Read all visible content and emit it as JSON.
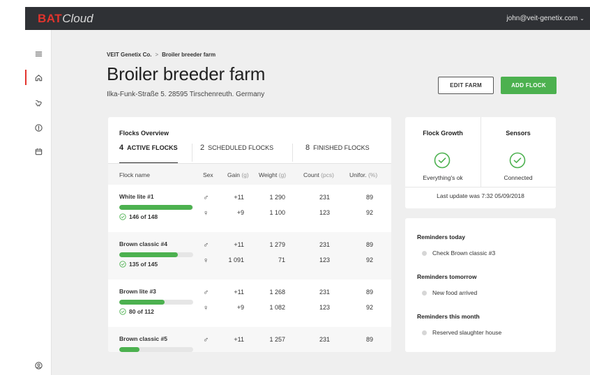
{
  "app": {
    "brand_bold": "BAT",
    "brand_light": "Cloud",
    "user_email": "john@veit-genetix.com"
  },
  "sidebar": {
    "icons": [
      "menu-icon",
      "home-icon",
      "chicken-icon",
      "alert-icon",
      "calendar-icon",
      "account-icon"
    ],
    "active": "home-icon"
  },
  "breadcrumb": {
    "company": "VEIT Genetix Co.",
    "separator": ">",
    "current": "Broiler breeder farm"
  },
  "page": {
    "title": "Broiler breeder farm",
    "address": "Ilka-Funk-Straße 5. 28595 Tirschenreuth. Germany"
  },
  "actions": {
    "edit_label": "EDIT FARM",
    "add_label": "ADD FLOCK"
  },
  "flocks": {
    "title": "Flocks Overview",
    "tabs": [
      {
        "count": "4",
        "label": "ACTIVE FLOCKS",
        "active": true
      },
      {
        "count": "2",
        "label": "SCHEDULED FLOCKS",
        "active": false
      },
      {
        "count": "8",
        "label": "FINISHED FLOCKS",
        "active": false
      }
    ],
    "columns": {
      "name": "Flock name",
      "sex": "Sex",
      "gain": "Gain",
      "gain_unit": "(g)",
      "weight": "Weight",
      "weight_unit": "(g)",
      "count": "Count",
      "count_unit": "(pcs)",
      "uniformity": "Unifor.",
      "uniformity_unit": "(%)"
    },
    "rows": [
      {
        "name": "White lite #1",
        "progress": 0.99,
        "progress_label": "146 of 148",
        "male": {
          "sex": "♂",
          "gain": "+11",
          "weight": "1 290",
          "count": "231",
          "uniformity": "89"
        },
        "female": {
          "sex": "♀",
          "gain": "+9",
          "weight": "1 100",
          "count": "123",
          "uniformity": "92"
        }
      },
      {
        "name": "Brown classic #4",
        "progress": 0.79,
        "progress_label": "135 of 145",
        "male": {
          "sex": "♂",
          "gain": "+11",
          "weight": "1 279",
          "count": "231",
          "uniformity": "89"
        },
        "female": {
          "sex": "♀",
          "gain": "1 091",
          "weight": "71",
          "count": "123",
          "uniformity": "92"
        }
      },
      {
        "name": "Brown lite #3",
        "progress": 0.61,
        "progress_label": "80 of 112",
        "male": {
          "sex": "♂",
          "gain": "+11",
          "weight": "1 268",
          "count": "231",
          "uniformity": "89"
        },
        "female": {
          "sex": "♀",
          "gain": "+9",
          "weight": "1 082",
          "count": "123",
          "uniformity": "92"
        }
      },
      {
        "name": "Brown classic #5",
        "progress": 0.27,
        "progress_label": "",
        "male": {
          "sex": "♂",
          "gain": "+11",
          "weight": "1 257",
          "count": "231",
          "uniformity": "89"
        }
      }
    ]
  },
  "status": {
    "growth_title": "Flock Growth",
    "growth_status": "Everything's ok",
    "sensors_title": "Sensors",
    "sensors_status": "Connected",
    "last_update": "Last update was 7:32 05/09/2018"
  },
  "reminders": {
    "today_title": "Reminders today",
    "today_item": "Check Brown classic #3",
    "tomorrow_title": "Reminders tomorrow",
    "tomorrow_item": "New food arrived",
    "month_title": "Reminders this month",
    "month_item": "Reserved slaughter house"
  },
  "colors": {
    "accent_green": "#4cb14f",
    "brand_red": "#e2342d",
    "topbar": "#2f3135"
  }
}
